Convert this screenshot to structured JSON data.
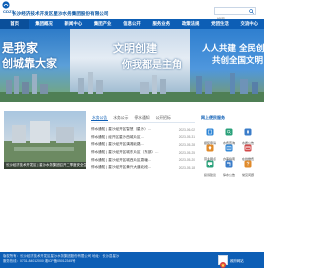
{
  "header": {
    "logo_abbr": "CDZS",
    "site_title": "长沙经济技术开发区星沙水务集团股份有限公司",
    "search_placeholder": "搜索"
  },
  "nav": {
    "items": [
      "首页",
      "集团概况",
      "新闻中心",
      "集团产业",
      "信息公开",
      "服务业务",
      "政策法规",
      "党团生活",
      "交流中心"
    ]
  },
  "banner": {
    "left_line1": "是我家",
    "left_line2": "创城靠大家",
    "mid_line1": "文明创建",
    "mid_line2": "你我都是主角",
    "right_line1": "人人共建 全民创",
    "right_line2": "共创全国文明"
  },
  "news": {
    "image_caption": "长沙经济技术开发区 | 星沙水务集团召开二季度安全生产…",
    "tabs": [
      "水务公告",
      "水务公示",
      "停水通知",
      "公开招标"
    ],
    "items": [
      {
        "title": "停水通知 | 星沙经开区智慧（星沙）…",
        "date": "2023-06-02"
      },
      {
        "title": "停水通知 | 经开区星沙西城片区…",
        "date": "2023-05-31"
      },
      {
        "title": "停水通知 | 星沙经开区漓湘北路…",
        "date": "2023-05-28"
      },
      {
        "title": "停水通知 | 星沙经开区城东片区（东部）…",
        "date": "2023-05-25"
      },
      {
        "title": "停水通知 | 星沙经开区城西片区泉塘…",
        "date": "2023-05-20"
      },
      {
        "title": "停水通知 | 星沙经开区黄兴大道北段…",
        "date": "2023-05-18"
      }
    ]
  },
  "services": {
    "title": "网上便民服务",
    "items": [
      {
        "label": "报装申请",
        "icon": "document-icon",
        "color": "#2f86d6"
      },
      {
        "label": "水费查询",
        "icon": "search-icon",
        "color": "#2aa17a"
      },
      {
        "label": "水质公告",
        "icon": "droplet-icon",
        "color": "#3a7cc9"
      },
      {
        "label": "营业网点",
        "icon": "location-icon",
        "color": "#e08a2a"
      },
      {
        "label": "办事指南",
        "icon": "book-icon",
        "color": "#2f86d6"
      },
      {
        "label": "在线缴费",
        "icon": "card-icon",
        "color": "#d24b4b"
      },
      {
        "label": "投诉建议",
        "icon": "chat-icon",
        "color": "#2aa17a"
      },
      {
        "label": "停水公告",
        "icon": "tap-icon",
        "color": "#3a7cc9"
      },
      {
        "label": "常见问题",
        "icon": "question-icon",
        "color": "#e08a2a"
      }
    ]
  },
  "footer": {
    "line1": "版权所有：长沙经济技术开发区星沙水务集团股份有限公司  地址：长沙县星沙",
    "line2": "服务热线：0731-84012000  湘ICP备05012345号",
    "right_label": "政府网站"
  },
  "colors": {
    "primary": "#0d5eb5",
    "nav_active": "#0a4f9a"
  }
}
